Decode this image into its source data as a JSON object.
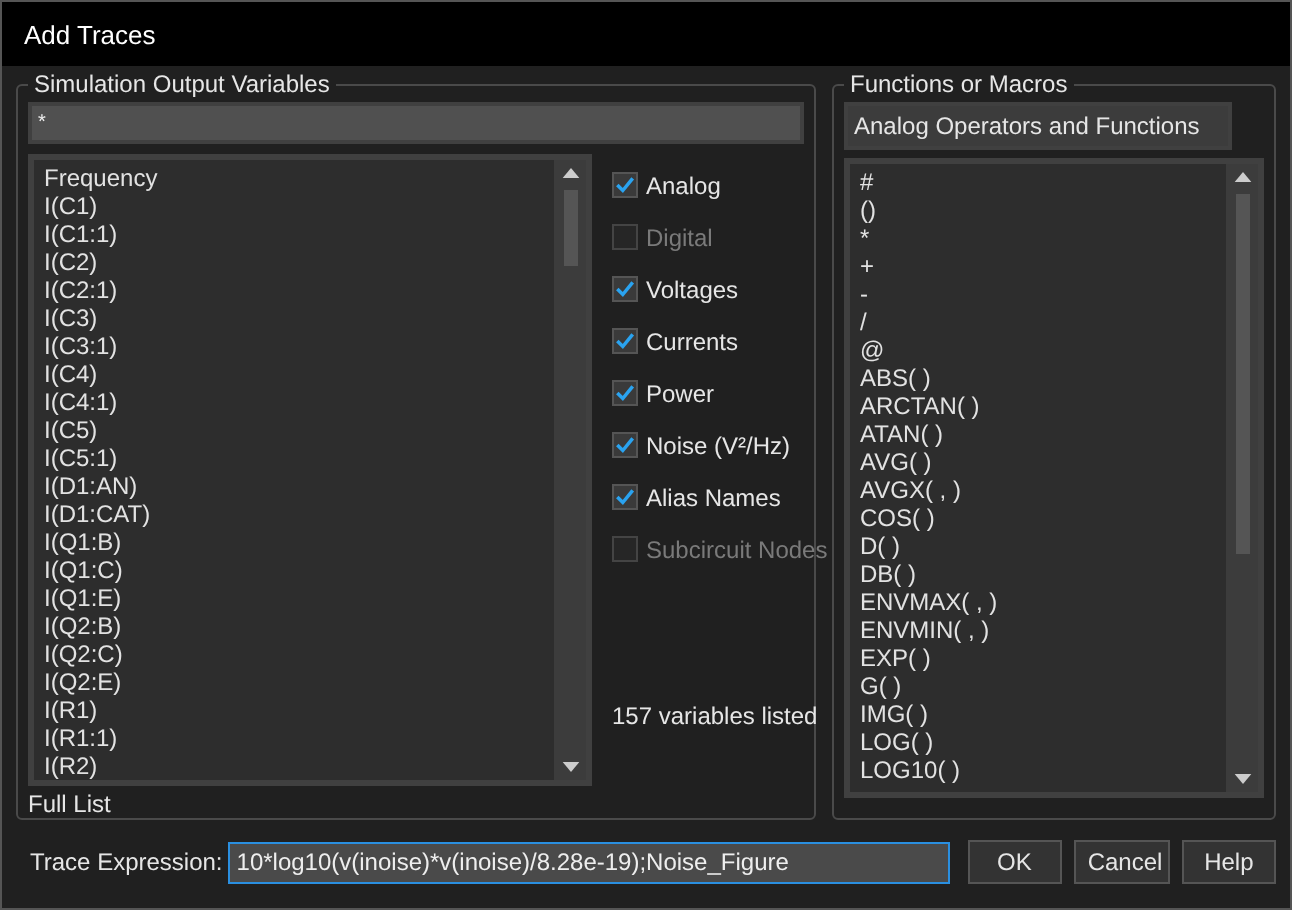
{
  "window": {
    "title": "Add Traces"
  },
  "output_variables": {
    "title": "Simulation Output Variables",
    "filter": {
      "value": "*"
    },
    "items": [
      "Frequency",
      "I(C1)",
      "I(C1:1)",
      "I(C2)",
      "I(C2:1)",
      "I(C3)",
      "I(C3:1)",
      "I(C4)",
      "I(C4:1)",
      "I(C5)",
      "I(C5:1)",
      "I(D1:AN)",
      "I(D1:CAT)",
      "I(Q1:B)",
      "I(Q1:C)",
      "I(Q1:E)",
      "I(Q2:B)",
      "I(Q2:C)",
      "I(Q2:E)",
      "I(R1)",
      "I(R1:1)",
      "I(R2)"
    ],
    "footer": "Full List"
  },
  "options": [
    {
      "label": "Analog",
      "checked": true,
      "disabled": false
    },
    {
      "label": "Digital",
      "checked": false,
      "disabled": true
    },
    {
      "label": "Voltages",
      "checked": true,
      "disabled": false
    },
    {
      "label": "Currents",
      "checked": true,
      "disabled": false
    },
    {
      "label": "Power",
      "checked": true,
      "disabled": false
    },
    {
      "label": "Noise (V²/Hz)",
      "checked": true,
      "disabled": false
    },
    {
      "label": "Alias Names",
      "checked": true,
      "disabled": false
    },
    {
      "label": "Subcircuit Nodes",
      "checked": false,
      "disabled": true
    }
  ],
  "count": "157 variables listed",
  "functions": {
    "title": "Functions or Macros",
    "category": "Analog Operators and Functions",
    "items": [
      "#",
      "()",
      "*",
      "+",
      "-",
      "/",
      "@",
      "ABS( )",
      "ARCTAN( )",
      "ATAN( )",
      "AVG( )",
      "AVGX( , )",
      "COS( )",
      "D( )",
      "DB( )",
      "ENVMAX( , )",
      "ENVMIN( , )",
      "EXP( )",
      "G( )",
      "IMG( )",
      "LOG( )",
      "LOG10( )"
    ]
  },
  "expression": {
    "label": "Trace Expression:",
    "value": "10*log10(v(inoise)*v(inoise)/8.28e-19);Noise_Figure"
  },
  "buttons": [
    "OK",
    "Cancel",
    "Help"
  ]
}
